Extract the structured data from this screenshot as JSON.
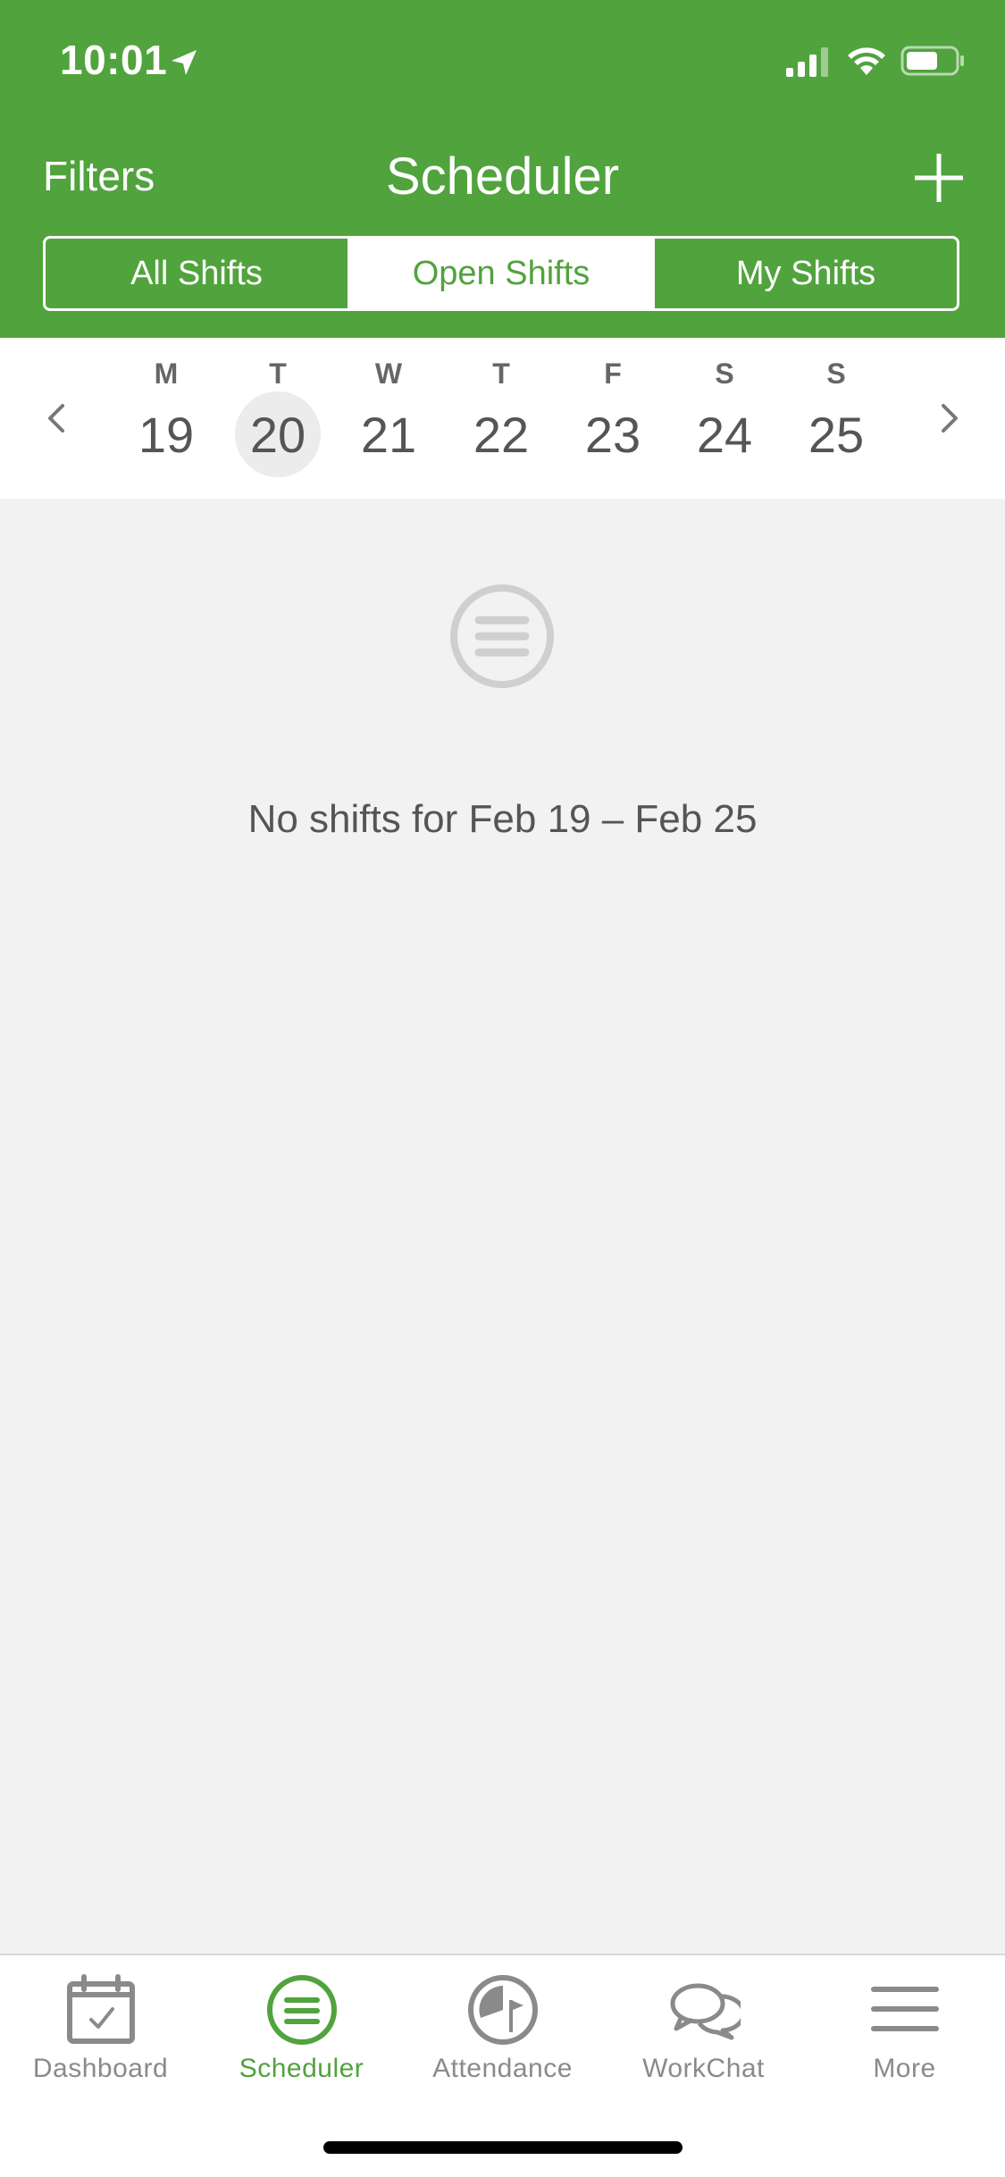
{
  "status_bar": {
    "time": "10:01"
  },
  "header": {
    "filters_label": "Filters",
    "title": "Scheduler",
    "add_icon": "plus-icon"
  },
  "segments": {
    "all": "All Shifts",
    "open": "Open Shifts",
    "my": "My Shifts",
    "selected": "Open Shifts"
  },
  "week": {
    "days": [
      {
        "letter": "M",
        "num": "19"
      },
      {
        "letter": "T",
        "num": "20"
      },
      {
        "letter": "W",
        "num": "21"
      },
      {
        "letter": "T",
        "num": "22"
      },
      {
        "letter": "F",
        "num": "23"
      },
      {
        "letter": "S",
        "num": "24"
      },
      {
        "letter": "S",
        "num": "25"
      }
    ],
    "today": "20"
  },
  "empty_state": {
    "icon": "scheduler-icon",
    "message": "No shifts for Feb 19 – Feb 25"
  },
  "tabs": [
    {
      "label": "Dashboard",
      "icon": "calendar-check-icon"
    },
    {
      "label": "Scheduler",
      "icon": "scheduler-icon"
    },
    {
      "label": "Attendance",
      "icon": "attendance-clock-icon"
    },
    {
      "label": "WorkChat",
      "icon": "chat-bubbles-icon"
    },
    {
      "label": "More",
      "icon": "menu-icon"
    }
  ],
  "active_tab": "Scheduler",
  "colors": {
    "brand_green": "#51a33d",
    "inactive_gray": "#8a8a8a",
    "background": "#f2f2f2"
  }
}
